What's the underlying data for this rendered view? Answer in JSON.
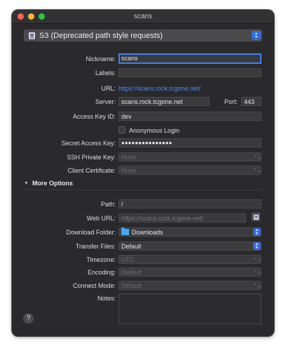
{
  "window": {
    "title": "scans"
  },
  "protocol": {
    "selected": "S3 (Deprecated path style requests)"
  },
  "form": {
    "nickname": {
      "label": "Nickname:",
      "value": "scans"
    },
    "labels": {
      "label": "Labels:",
      "value": ""
    },
    "url": {
      "label": "URL:",
      "value": "https://scans.rock.tcgone.net/"
    },
    "server": {
      "label": "Server:",
      "value": "scans.rock.tcgone.net"
    },
    "port": {
      "label": "Port:",
      "value": "443"
    },
    "access_key": {
      "label": "Access Key ID:",
      "value": "dev"
    },
    "anonymous": {
      "label": "Anonymous Login",
      "checked": false
    },
    "secret": {
      "label": "Secret Access Key:",
      "value": "●●●●●●●●●●●●●●●"
    },
    "ssh_key": {
      "label": "SSH Private Key:",
      "value": "None"
    },
    "client_cert": {
      "label": "Client Certificate:",
      "value": "None"
    }
  },
  "more_options": {
    "title": "More Options",
    "path": {
      "label": "Path:",
      "value": "/"
    },
    "web_url": {
      "label": "Web URL:",
      "placeholder": "https://scans.rock.tcgone.net/"
    },
    "download_folder": {
      "label": "Download Folder:",
      "value": "Downloads"
    },
    "transfer_files": {
      "label": "Transfer Files:",
      "value": "Default"
    },
    "timezone": {
      "label": "Timezone:",
      "value": "UTC"
    },
    "encoding": {
      "label": "Encoding:",
      "value": "Default"
    },
    "connect_mode": {
      "label": "Connect Mode:",
      "value": "Default"
    },
    "notes": {
      "label": "Notes:",
      "value": ""
    }
  },
  "help": {
    "label": "?"
  },
  "colors": {
    "accent": "#2f6fdf",
    "link": "#4c8dff",
    "window_bg": "#2a2a2c"
  }
}
